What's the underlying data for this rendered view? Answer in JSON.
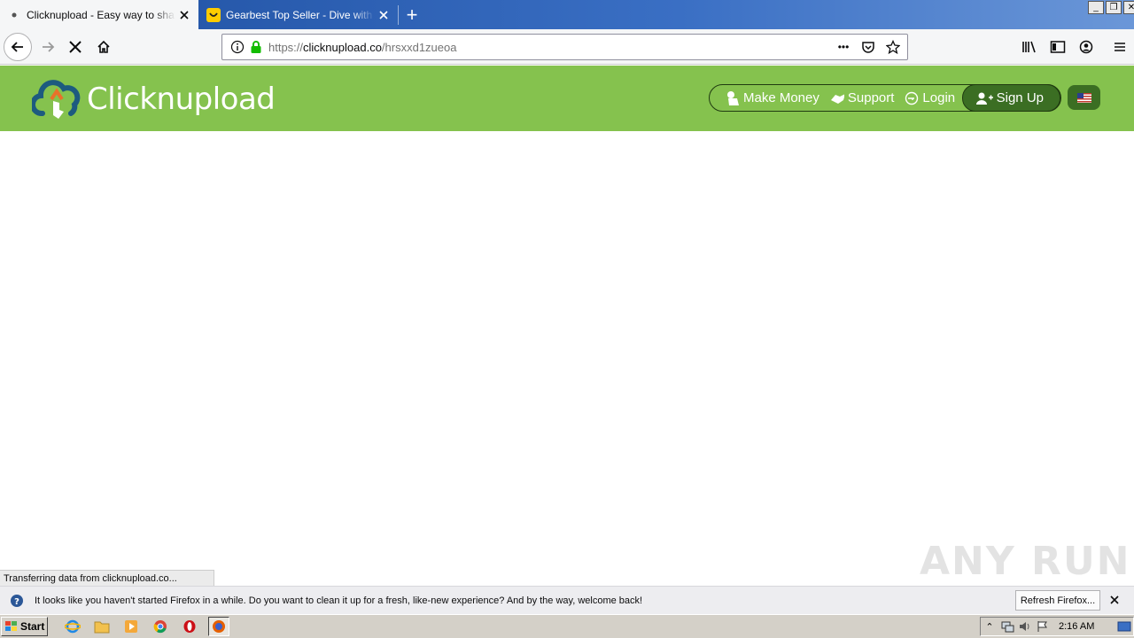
{
  "browser": {
    "tabs": [
      {
        "title": "Clicknupload - Easy way to share your files",
        "active": true
      },
      {
        "title": "Gearbest Top Seller - Dive with the best",
        "active": false
      }
    ],
    "new_tab": "+",
    "url": {
      "scheme": "https://",
      "host": "clicknupload.co",
      "path": "/hrsxxd1zueoa"
    },
    "page_actions_more": "•••"
  },
  "site": {
    "logo_text": "Clicknupload",
    "nav": {
      "make_money": "Make Money",
      "support": "Support",
      "login": "Login",
      "sign_up": "Sign Up"
    },
    "colors": {
      "header_bg": "#85c24e",
      "dark_green": "#3b6e23"
    }
  },
  "status_text": "Transferring data from clicknupload.co...",
  "watermark": "ANY RUN",
  "notification": {
    "message": "It looks like you haven't started Firefox in a while. Do you want to clean it up for a fresh, like-new experience? And by the way, welcome back!",
    "button": "Refresh Firefox..."
  },
  "taskbar": {
    "start": "Start",
    "clock": "2:16 AM"
  }
}
